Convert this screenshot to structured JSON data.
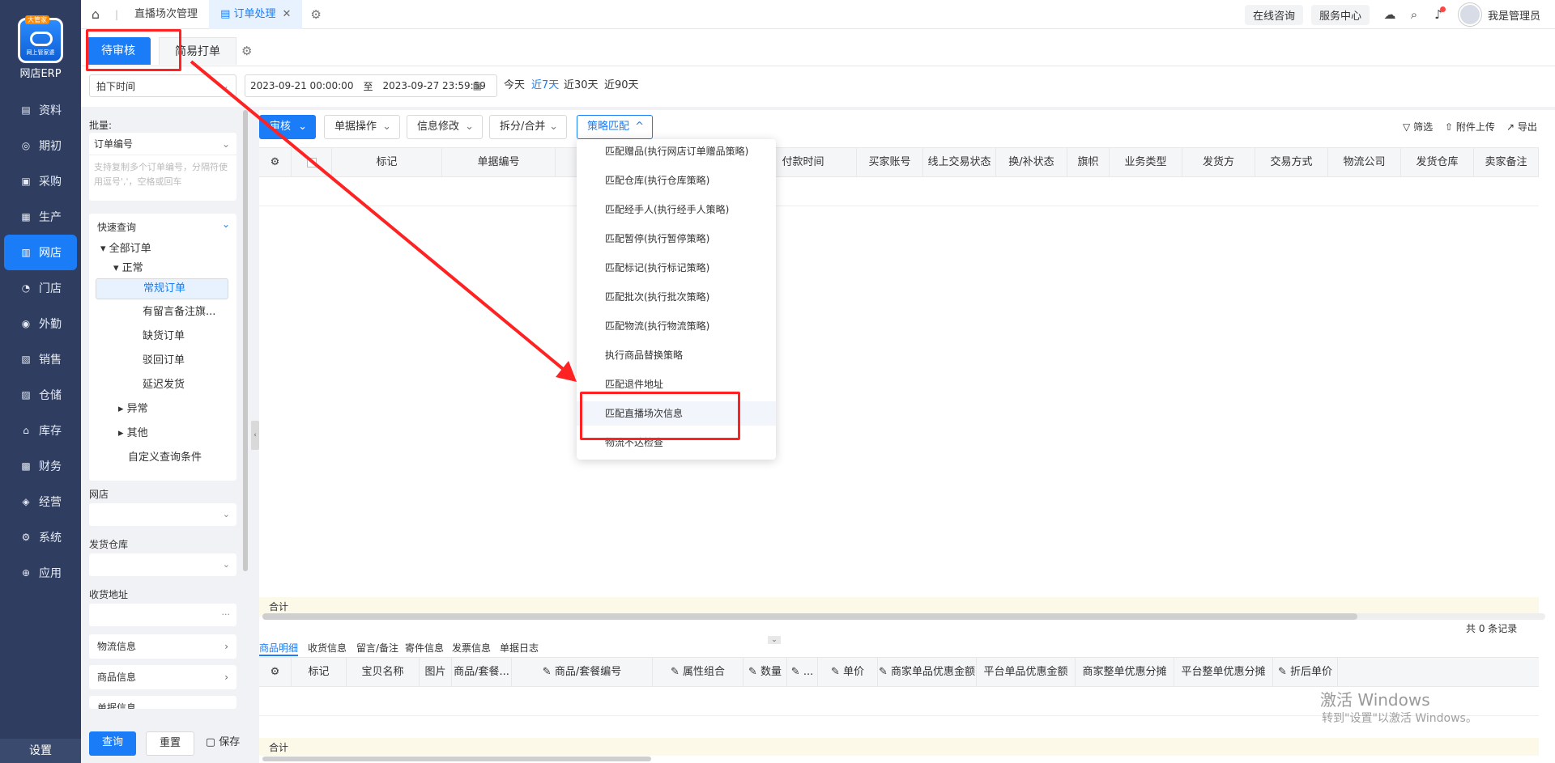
{
  "app": {
    "name": "网店ERP",
    "logo_tag": "大管家",
    "logo_sub": "网上管家婆",
    "settings": "设置"
  },
  "nav": [
    {
      "label": "资料",
      "icon": "book-icon"
    },
    {
      "label": "期初",
      "icon": "target-icon"
    },
    {
      "label": "采购",
      "icon": "purchase-icon"
    },
    {
      "label": "生产",
      "icon": "production-icon"
    },
    {
      "label": "网店",
      "icon": "shop-icon"
    },
    {
      "label": "门店",
      "icon": "pie-icon"
    },
    {
      "label": "外勤",
      "icon": "compass-icon"
    },
    {
      "label": "销售",
      "icon": "chart-icon"
    },
    {
      "label": "仓储",
      "icon": "warehouse-icon"
    },
    {
      "label": "库存",
      "icon": "home-stock-icon"
    },
    {
      "label": "财务",
      "icon": "finance-icon"
    },
    {
      "label": "经营",
      "icon": "business-icon"
    },
    {
      "label": "系统",
      "icon": "gear-icon"
    },
    {
      "label": "应用",
      "icon": "plus-icon"
    }
  ],
  "topbar": {
    "tabs": [
      "直播场次管理",
      "订单处理"
    ],
    "online": "在线咨询",
    "service": "服务中心",
    "user": "我是管理员"
  },
  "subtabs": [
    "待审核",
    "简易打单"
  ],
  "filter": {
    "time_type": "拍下时间",
    "start": "2023-09-21 00:00:00",
    "to": "至",
    "end": "2023-09-27 23:59:59",
    "quick": [
      "今天",
      "近7天",
      "近30天",
      "近90天"
    ]
  },
  "left": {
    "batch_label": "批量:",
    "batch_field": "订单编号",
    "batch_placeholder": "支持复制多个订单编号，分隔符使用逗号','，空格或回车",
    "quick_title": "快速查询",
    "tree": {
      "all": "全部订单",
      "normal": "正常",
      "regular": "常规订单",
      "remark": "有留言备注旗...",
      "shortage": "缺货订单",
      "rejected": "驳回订单",
      "delayed": "延迟发货",
      "abnormal": "异常",
      "other": "其他",
      "custom": "自定义查询条件"
    },
    "shop_label": "网店",
    "warehouse_label": "发货仓库",
    "address_label": "收货地址",
    "acc": [
      "物流信息",
      "商品信息",
      "单据信息"
    ],
    "query": "查询",
    "reset": "重置",
    "save": "保存"
  },
  "toolbar": {
    "audit": "审核",
    "single_ops": "单据操作",
    "info_modify": "信息修改",
    "split_merge": "拆分/合并",
    "strategy": "策略匹配",
    "filter": "筛选",
    "attach": "附件上传",
    "export": "导出"
  },
  "grid": {
    "headers": [
      "标记",
      "单据编号",
      "付款时间",
      "买家账号",
      "线上交易状态",
      "换/补状态",
      "旗帜",
      "业务类型",
      "发货方",
      "交易方式",
      "物流公司",
      "发货仓库",
      "卖家备注"
    ],
    "sum": "合计",
    "records": "共 0 条记录"
  },
  "bottom": {
    "tabs": [
      "商品明细",
      "收货信息",
      "留言/备注",
      "寄件信息",
      "发票信息",
      "单据日志"
    ],
    "headers": [
      "标记",
      "宝贝名称",
      "图片",
      "商品/套餐...",
      "商品/套餐编号",
      "属性组合",
      "数量",
      "...",
      "单价",
      "商家单品优惠金额",
      "平台单品优惠金额",
      "商家整单优惠分摊",
      "平台整单优惠分摊",
      "折后单价"
    ],
    "sum": "合计"
  },
  "dropdown": [
    "匹配赠品(执行网店订单赠品策略)",
    "匹配仓库(执行仓库策略)",
    "匹配经手人(执行经手人策略)",
    "匹配暂停(执行暂停策略)",
    "匹配标记(执行标记策略)",
    "匹配批次(执行批次策略)",
    "匹配物流(执行物流策略)",
    "执行商品替换策略",
    "匹配退件地址",
    "匹配直播场次信息",
    "物流不达检查"
  ],
  "watermark": {
    "line1": "激活 Windows",
    "line2": "转到\"设置\"以激活 Windows。"
  },
  "colors": {
    "accent": "#1a7cf6",
    "sidebar": "#2e3d60",
    "annotation": "#ff2222"
  }
}
